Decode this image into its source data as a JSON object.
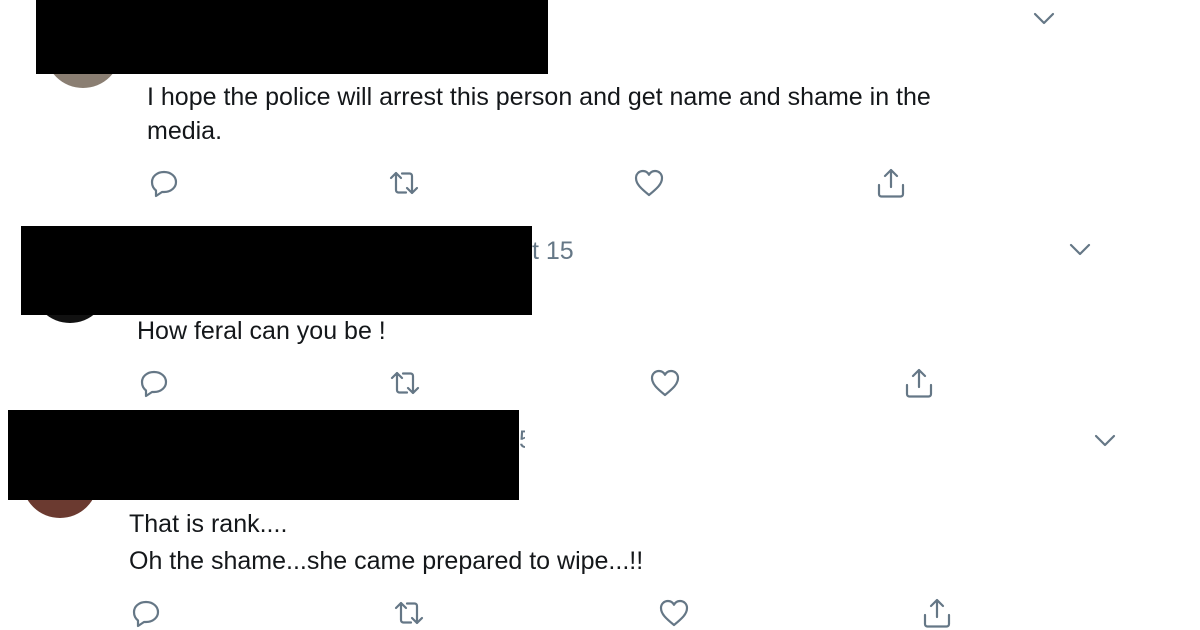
{
  "colors": {
    "text": "#14171a",
    "secondary": "#657786",
    "redaction": "#000000"
  },
  "tweets": [
    {
      "meta_fragment": "",
      "lines": [
        "I hope the police will arrest this person and get name and shame in the",
        "media."
      ],
      "icons": [
        "reply-icon",
        "retweet-icon",
        "like-icon",
        "share-icon",
        "chevron-down-icon"
      ]
    },
    {
      "meta_fragment": "t 15",
      "lines": [
        "How feral can you be !"
      ],
      "icons": [
        "reply-icon",
        "retweet-icon",
        "like-icon",
        "share-icon",
        "chevron-down-icon"
      ]
    },
    {
      "meta_fragment": "5",
      "lines": [
        "That is rank....",
        "Oh the shame...she came prepared to wipe...!!"
      ],
      "icons": [
        "reply-icon",
        "retweet-icon",
        "like-icon",
        "share-icon",
        "chevron-down-icon"
      ]
    }
  ]
}
